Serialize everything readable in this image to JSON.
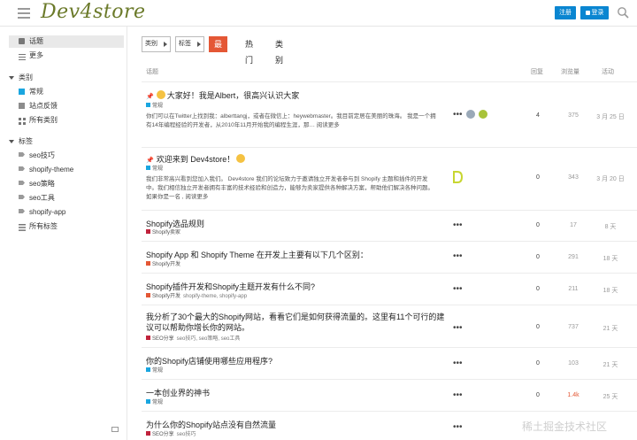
{
  "header": {
    "logo": "Dev4store",
    "register_label": "注册",
    "login_label": "登录"
  },
  "sidebar": {
    "top_items": [
      {
        "label": "话题",
        "icon": "topics-icon",
        "active": true
      },
      {
        "label": "更多",
        "icon": "more-icon",
        "active": false
      }
    ],
    "categories_heading": "类别",
    "categories": [
      {
        "label": "常规",
        "color": "#1aa6e0"
      },
      {
        "label": "站点反馈",
        "color": "#8c8c8c"
      },
      {
        "label": "所有类别",
        "color": "#8c8c8c"
      }
    ],
    "tags_heading": "标签",
    "tags": [
      {
        "label": "seo技巧"
      },
      {
        "label": "shopify-theme"
      },
      {
        "label": "seo策略"
      },
      {
        "label": "seo工具"
      },
      {
        "label": "shopify-app"
      },
      {
        "label": "所有标签"
      }
    ]
  },
  "nav": {
    "category_dropdown": "类别",
    "tag_dropdown": "标签",
    "tabs": [
      {
        "label": "最新",
        "active": true
      },
      {
        "label": "热门",
        "active": false
      },
      {
        "label": "类别",
        "active": false
      }
    ]
  },
  "table": {
    "headers": {
      "topic": "话题",
      "replies": "回复",
      "views": "浏览量",
      "activity": "活动"
    }
  },
  "topics": [
    {
      "title": "大家好！我是Albert，很高兴认识大家",
      "pinned": true,
      "emoji": true,
      "category": "常规",
      "category_color": "#1aa6e0",
      "tags": "",
      "excerpt": "你们可以在Twitter上找到我：alberttangj，或者在微信上：heywebmaster。我目前定居在美丽的珠海。 我是一个拥有14年编程经验的开发者，从2010年11月开始我的编程生涯，那… 阅读更多",
      "replies": "4",
      "views": "375",
      "activity": "3 月 25 日",
      "views_hot": false
    },
    {
      "title": "欢迎来到 Dev4store！",
      "pinned": true,
      "emoji": true,
      "category": "常规",
      "category_color": "#1aa6e0",
      "tags": "",
      "excerpt": "我们非常高兴看到您加入我们。 Dev4store 我们的论坛致力于邀请独立开发者参与到 Shopify 主题和插件的开发中。我们相信独立开发者拥有丰富的技术经验和创造力，能够为卖家提供各种解决方案，帮助他们解决各种问题。 如果你是一名 , 阅读更多",
      "replies": "0",
      "views": "343",
      "activity": "3 月 20 日",
      "views_hot": false
    },
    {
      "title": "Shopify选品规则",
      "pinned": false,
      "emoji": false,
      "category": "Shopify卖家",
      "category_color": "#c0233c",
      "tags": "",
      "excerpt": "",
      "replies": "0",
      "views": "17",
      "activity": "8 天",
      "views_hot": false
    },
    {
      "title": "Shopify App 和 Shopify Theme 在开发上主要有以下几个区别：",
      "pinned": false,
      "emoji": false,
      "category": "Shopify开发",
      "category_color": "#e45735",
      "tags": "",
      "excerpt": "",
      "replies": "0",
      "views": "291",
      "activity": "18 天",
      "views_hot": false
    },
    {
      "title": "Shopify插件开发和Shopify主题开发有什么不同?",
      "pinned": false,
      "emoji": false,
      "category": "Shopify开发",
      "category_color": "#e45735",
      "tags": "shopify-theme, shopify-app",
      "excerpt": "",
      "replies": "0",
      "views": "211",
      "activity": "18 天",
      "views_hot": false
    },
    {
      "title": "我分析了30个最大的Shopify网站，看看它们是如何获得流量的。这里有11个可行的建议可以帮助你增长你的网站。",
      "pinned": false,
      "emoji": false,
      "category": "SEO分享",
      "category_color": "#c0233c",
      "tags": "seo技巧, seo策略, seo工具",
      "excerpt": "",
      "replies": "0",
      "views": "737",
      "activity": "21 天",
      "views_hot": false
    },
    {
      "title": "你的Shopify店铺使用哪些应用程序?",
      "pinned": false,
      "emoji": false,
      "category": "常规",
      "category_color": "#1aa6e0",
      "tags": "",
      "excerpt": "",
      "replies": "0",
      "views": "103",
      "activity": "21 天",
      "views_hot": false
    },
    {
      "title": "一本创业界的神书",
      "pinned": false,
      "emoji": false,
      "category": "常规",
      "category_color": "#1aa6e0",
      "tags": "",
      "excerpt": "",
      "replies": "0",
      "views": "1.4k",
      "activity": "25 天",
      "views_hot": true
    },
    {
      "title": "为什么你的Shopify站点没有自然流量",
      "pinned": false,
      "emoji": false,
      "category": "SEO分享",
      "category_color": "#c0233c",
      "tags": "seo技巧",
      "excerpt": "",
      "replies": "0",
      "views": "",
      "activity": "",
      "views_hot": false
    }
  ],
  "watermark": "稀土掘金技术社区",
  "colors": {
    "accent": "#e45735",
    "primary": "#0a86d1"
  }
}
